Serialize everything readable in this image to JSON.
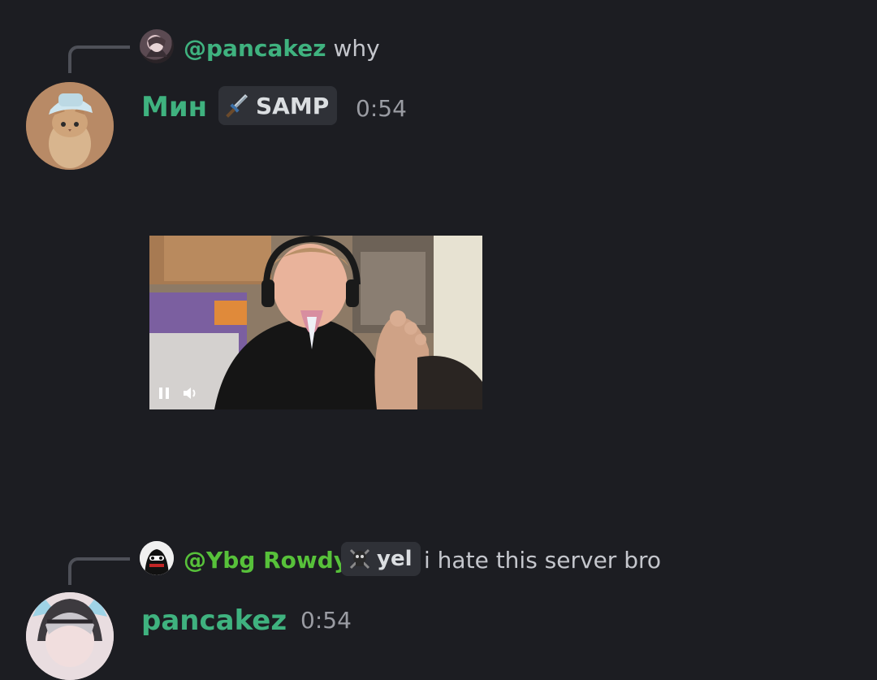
{
  "messages": [
    {
      "reply": {
        "mention": "@pancakez",
        "text": "why"
      },
      "author": "Мин",
      "tag": "SAMP",
      "timestamp": "0:54",
      "attachment": {
        "type": "video",
        "state": "playing"
      }
    },
    {
      "reply": {
        "mention": "@Ybg Rowdy",
        "tag": "yel",
        "text": "i hate this server bro"
      },
      "author": "pancakez",
      "timestamp": "0:54"
    }
  ],
  "colors": {
    "background": "#1c1d22",
    "username_green": "#3fb27f",
    "mention_green": "#57c13a",
    "tag_bg": "#2f3137",
    "timestamp": "#9a9ca3"
  },
  "icons": [
    "sword-icon",
    "skull-icon",
    "pause-icon",
    "volume-icon"
  ]
}
